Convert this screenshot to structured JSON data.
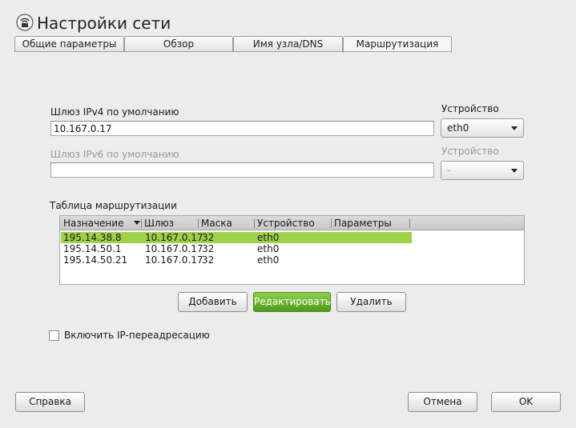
{
  "window": {
    "title": "Настройки сети",
    "icon": "network-settings-icon"
  },
  "tabs": [
    {
      "label": "Общие параметры",
      "active": false
    },
    {
      "label": "Обзор",
      "active": false
    },
    {
      "label": "Имя узла/DNS",
      "active": false
    },
    {
      "label": "Маршрутизация",
      "active": true
    }
  ],
  "ipv4": {
    "label": "Шлюз IPv4 по умолчанию",
    "value": "10.167.0.17",
    "device_label": "Устройство",
    "device_value": "eth0"
  },
  "ipv6": {
    "label": "Шлюз IPv6 по умолчанию",
    "value": "",
    "device_label": "Устройство",
    "device_value": "-",
    "enabled": false
  },
  "routing_table": {
    "label": "Таблица маршрутизации",
    "columns": [
      "Назначение",
      "Шлюз",
      "Маска",
      "Устройство",
      "Параметры"
    ],
    "rows": [
      {
        "destination": "195.14.38.8",
        "gateway": "10.167.0.17",
        "mask": "32",
        "device": "eth0",
        "options": "",
        "selected": true
      },
      {
        "destination": "195.14.50.1",
        "gateway": "10.167.0.17",
        "mask": "32",
        "device": "eth0",
        "options": "",
        "selected": false
      },
      {
        "destination": "195.14.50.21",
        "gateway": "10.167.0.17",
        "mask": "32",
        "device": "eth0",
        "options": "",
        "selected": false
      }
    ]
  },
  "table_buttons": {
    "add": "Добавить",
    "edit": "Редактировать",
    "delete": "Удалить"
  },
  "ip_forwarding": {
    "label": "Включить IP-переадресацию",
    "checked": false
  },
  "footer": {
    "help": "Справка",
    "cancel": "Отмена",
    "ok": "OK"
  },
  "colors": {
    "selection": "#9fd04a",
    "primary_button": "#5aa823",
    "background": "#ececec"
  }
}
